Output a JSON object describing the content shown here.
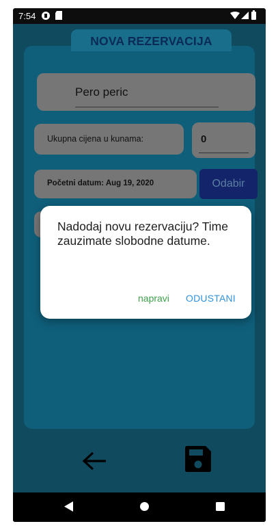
{
  "status_bar": {
    "time": "7:54"
  },
  "form": {
    "title": "NOVA REZERVACIJA",
    "name_value": "Pero peric",
    "price_label": "Ukupna cijena u kunama:",
    "price_value": "0",
    "start_date_label": "Početni datum: Aug 19, 2020",
    "pick_button": "Odabir"
  },
  "dialog": {
    "message": "Nadodaj novu rezervaciju? Time zauzimate slobodne datume.",
    "confirm_label": "napravi",
    "cancel_label": "ODUSTANI"
  },
  "colors": {
    "screen_bg": "#0f4a5e",
    "card_bg": "#0f5f7b",
    "field_bg": "#767676",
    "title_color": "#0b2a55",
    "pick_button_bg": "#13246b",
    "confirm_color": "#3da14a",
    "cancel_color": "#2f92dd"
  },
  "icons": [
    "back-arrow-icon",
    "save-floppy-icon",
    "nav-back-icon",
    "nav-home-icon",
    "nav-recents-icon"
  ]
}
